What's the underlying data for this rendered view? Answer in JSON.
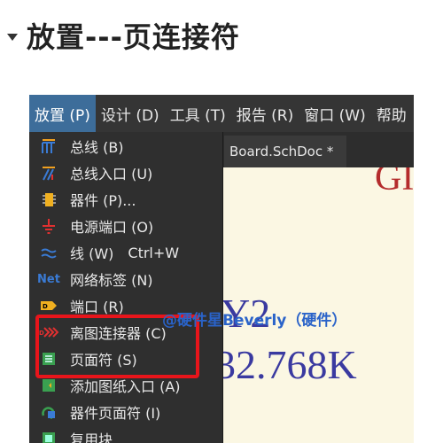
{
  "heading": {
    "text": "放置---页连接符"
  },
  "menubar": {
    "items": [
      "放置 (P)",
      "设计 (D)",
      "工具 (T)",
      "报告 (R)",
      "窗口 (W)",
      "帮助"
    ]
  },
  "tab": {
    "label": "Board.SchDoc *"
  },
  "document": {
    "g_text": "GI",
    "y2_text": "Y2",
    "freq_text": "32.768K"
  },
  "menu": {
    "items": [
      {
        "label": "总线 (B)",
        "icon": "bus-icon"
      },
      {
        "label": "总线入口 (U)",
        "icon": "bus-entry-icon"
      },
      {
        "label": "器件 (P)...",
        "icon": "part-icon"
      },
      {
        "label": "电源端口 (O)",
        "icon": "power-port-icon"
      },
      {
        "label": "线 (W)",
        "shortcut": "Ctrl+W",
        "icon": "wire-icon"
      },
      {
        "label": "网络标签 (N)",
        "icon": "net-label-icon",
        "icon_text": "Net"
      },
      {
        "label": "端口 (R)",
        "icon": "port-icon"
      },
      {
        "label": "离图连接器 (C)",
        "icon": "off-sheet-connector-icon"
      },
      {
        "label": "页面符 (S)",
        "icon": "sheet-symbol-icon"
      },
      {
        "label": "添加图纸入口 (A)",
        "icon": "sheet-entry-icon"
      },
      {
        "label": "器件页面符 (I)",
        "icon": "device-sheet-icon"
      },
      {
        "label": "复用块...",
        "icon": "reuse-block-icon"
      }
    ]
  },
  "watermark": {
    "text": "@硬件星Beverly（硬件）"
  },
  "colors": {
    "highlight": "#e8151b",
    "menu_active": "#3d6d9a"
  }
}
